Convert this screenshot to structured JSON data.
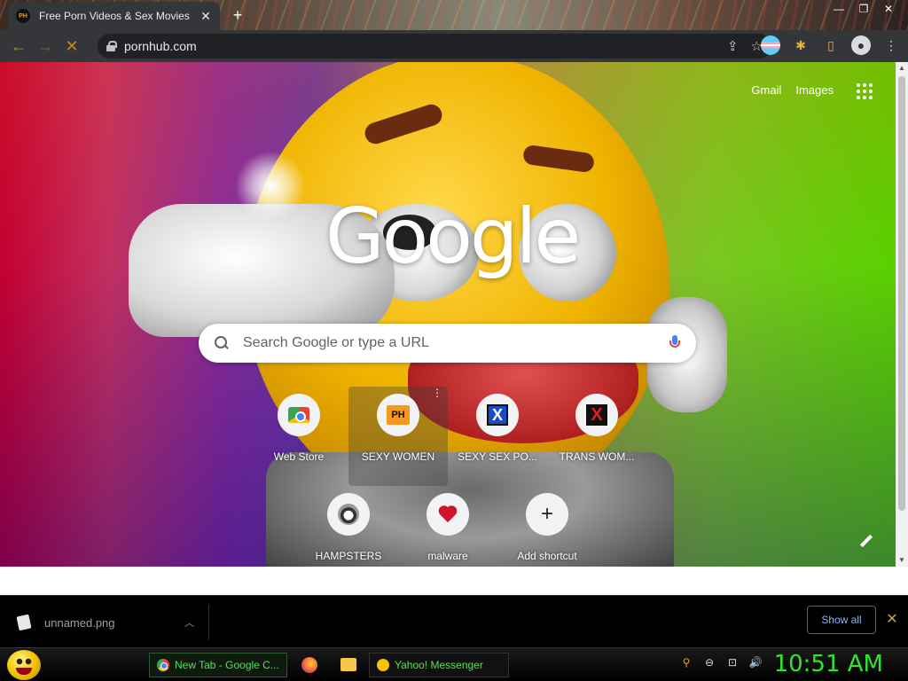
{
  "window": {
    "tab_title": "Free Porn Videos & Sex Movies -",
    "tab_favicon_text": "PH",
    "tab_close": "✕",
    "new_tab": "+",
    "controls": {
      "minimize": "—",
      "restore": "❐",
      "close": "✕"
    }
  },
  "toolbar": {
    "url": "pornhub.com",
    "back_icon": "←",
    "forward_icon": "→",
    "stop_icon": "✕",
    "share_icon": "⇪",
    "bookmark_icon": "☆",
    "extensions_icon": "✱",
    "sidepanel_icon": "▯",
    "menu_icon": "⋮",
    "profile_icon": "●"
  },
  "ntp": {
    "links": [
      "Gmail",
      "Images"
    ],
    "logo": "Google",
    "search_placeholder": "Search Google or type a URL",
    "shortcuts": [
      {
        "label": "Web Store",
        "icon": "webstore-icon"
      },
      {
        "label": "SEXY WOMEN",
        "icon": "ph-icon",
        "tile_text": "PH"
      },
      {
        "label": "SEXY SEX PO...",
        "icon": "x-blue-icon",
        "tile_text": "X"
      },
      {
        "label": "TRANS WOM...",
        "icon": "x-red-icon",
        "tile_text": "X"
      },
      {
        "label": "HAMPSTERS",
        "icon": "raccoon-icon"
      },
      {
        "label": "malware",
        "icon": "heart-icon"
      },
      {
        "label": "Add shortcut",
        "icon": "plus-icon",
        "tile_text": "+"
      }
    ],
    "shortcut_menu": "⋮"
  },
  "scrollbar": {
    "up": "▲",
    "down": "▼"
  },
  "downloads": {
    "file_name": "unnamed.png",
    "chevron": "︿",
    "show_all": "Show all",
    "close": "✕"
  },
  "taskbar": {
    "tasks": [
      {
        "label": "New Tab - Google C..."
      },
      {
        "label": "Yahoo! Messenger"
      }
    ],
    "tray_icons": [
      "⚲",
      "⊖",
      "⊡",
      "🔊"
    ],
    "clock": "10:51 AM"
  },
  "colors": {
    "accent_green": "#2ee62e",
    "toolbar_bg": "#35363a",
    "link_blue": "#8ab4f8"
  }
}
